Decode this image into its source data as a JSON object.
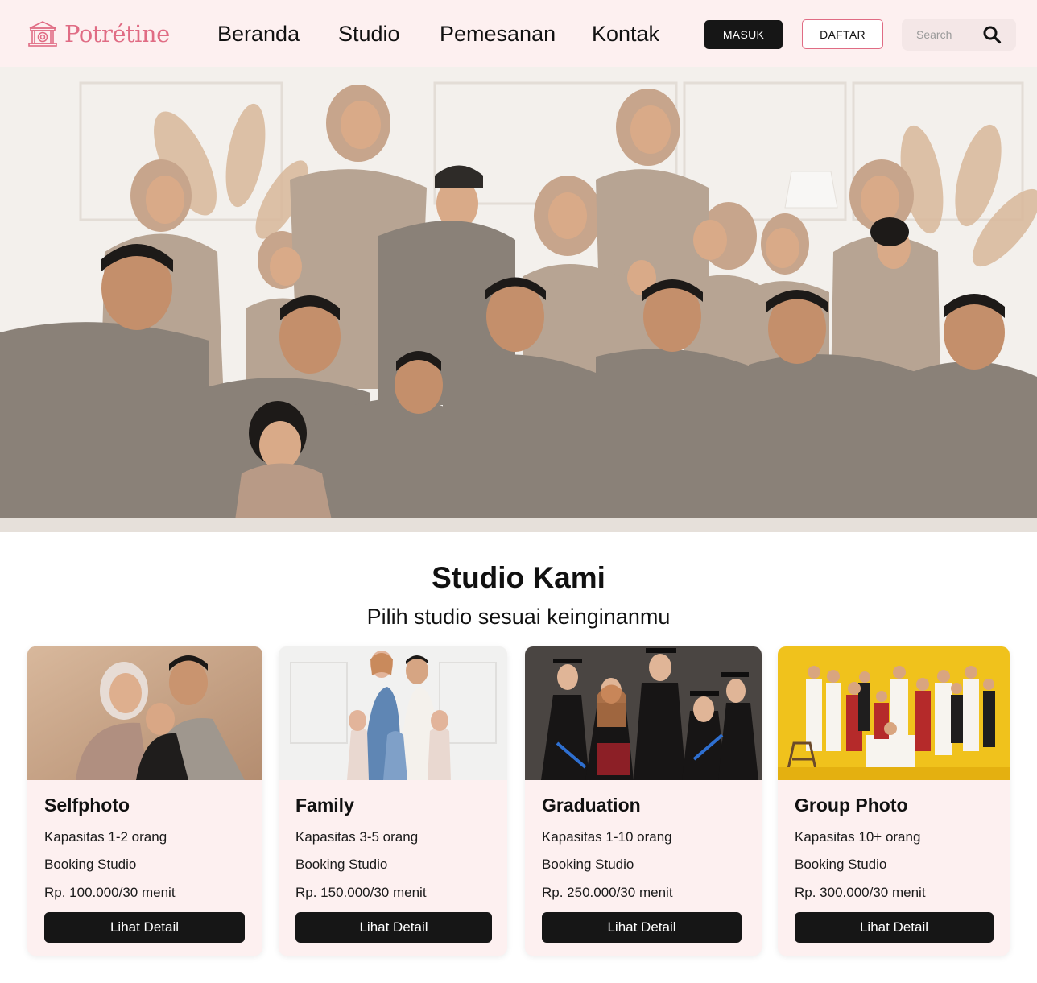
{
  "brand": {
    "name": "Potrétine",
    "accent_color": "#e06c84",
    "logo_icon": "temple-building-icon"
  },
  "nav": {
    "links": [
      {
        "label": "Beranda"
      },
      {
        "label": "Studio"
      },
      {
        "label": "Pemesanan"
      },
      {
        "label": "Kontak"
      }
    ],
    "masuk_label": "MASUK",
    "daftar_label": "DAFTAR",
    "search_placeholder": "Search",
    "search_icon": "search-icon"
  },
  "hero": {
    "image": "family-group-portrait-photo"
  },
  "studio_section": {
    "title": "Studio Kami",
    "subtitle": "Pilih studio sesuai keinginanmu",
    "cards": [
      {
        "title": "Selfphoto",
        "capacity": "Kapasitas 1-2 orang",
        "booking": "Booking Studio",
        "price": "Rp. 100.000/30 menit",
        "button": "Lihat Detail",
        "image": "couple-with-baby-photo"
      },
      {
        "title": "Family",
        "capacity": "Kapasitas 3-5 orang",
        "booking": "Booking Studio",
        "price": "Rp. 150.000/30 menit",
        "button": "Lihat Detail",
        "image": "family-photo"
      },
      {
        "title": "Graduation",
        "capacity": "Kapasitas 1-10 orang",
        "booking": "Booking Studio",
        "price": "Rp. 250.000/30 menit",
        "button": "Lihat Detail",
        "image": "graduation-group-photo"
      },
      {
        "title": "Group Photo",
        "capacity": "Kapasitas 10+ orang",
        "booking": "Booking Studio",
        "price": "Rp. 300.000/30 menit",
        "button": "Lihat Detail",
        "image": "large-group-photo"
      }
    ]
  },
  "colors": {
    "nav_bg": "#fdf0f0",
    "card_bg": "#fdf0f0",
    "button_dark": "#161616"
  }
}
